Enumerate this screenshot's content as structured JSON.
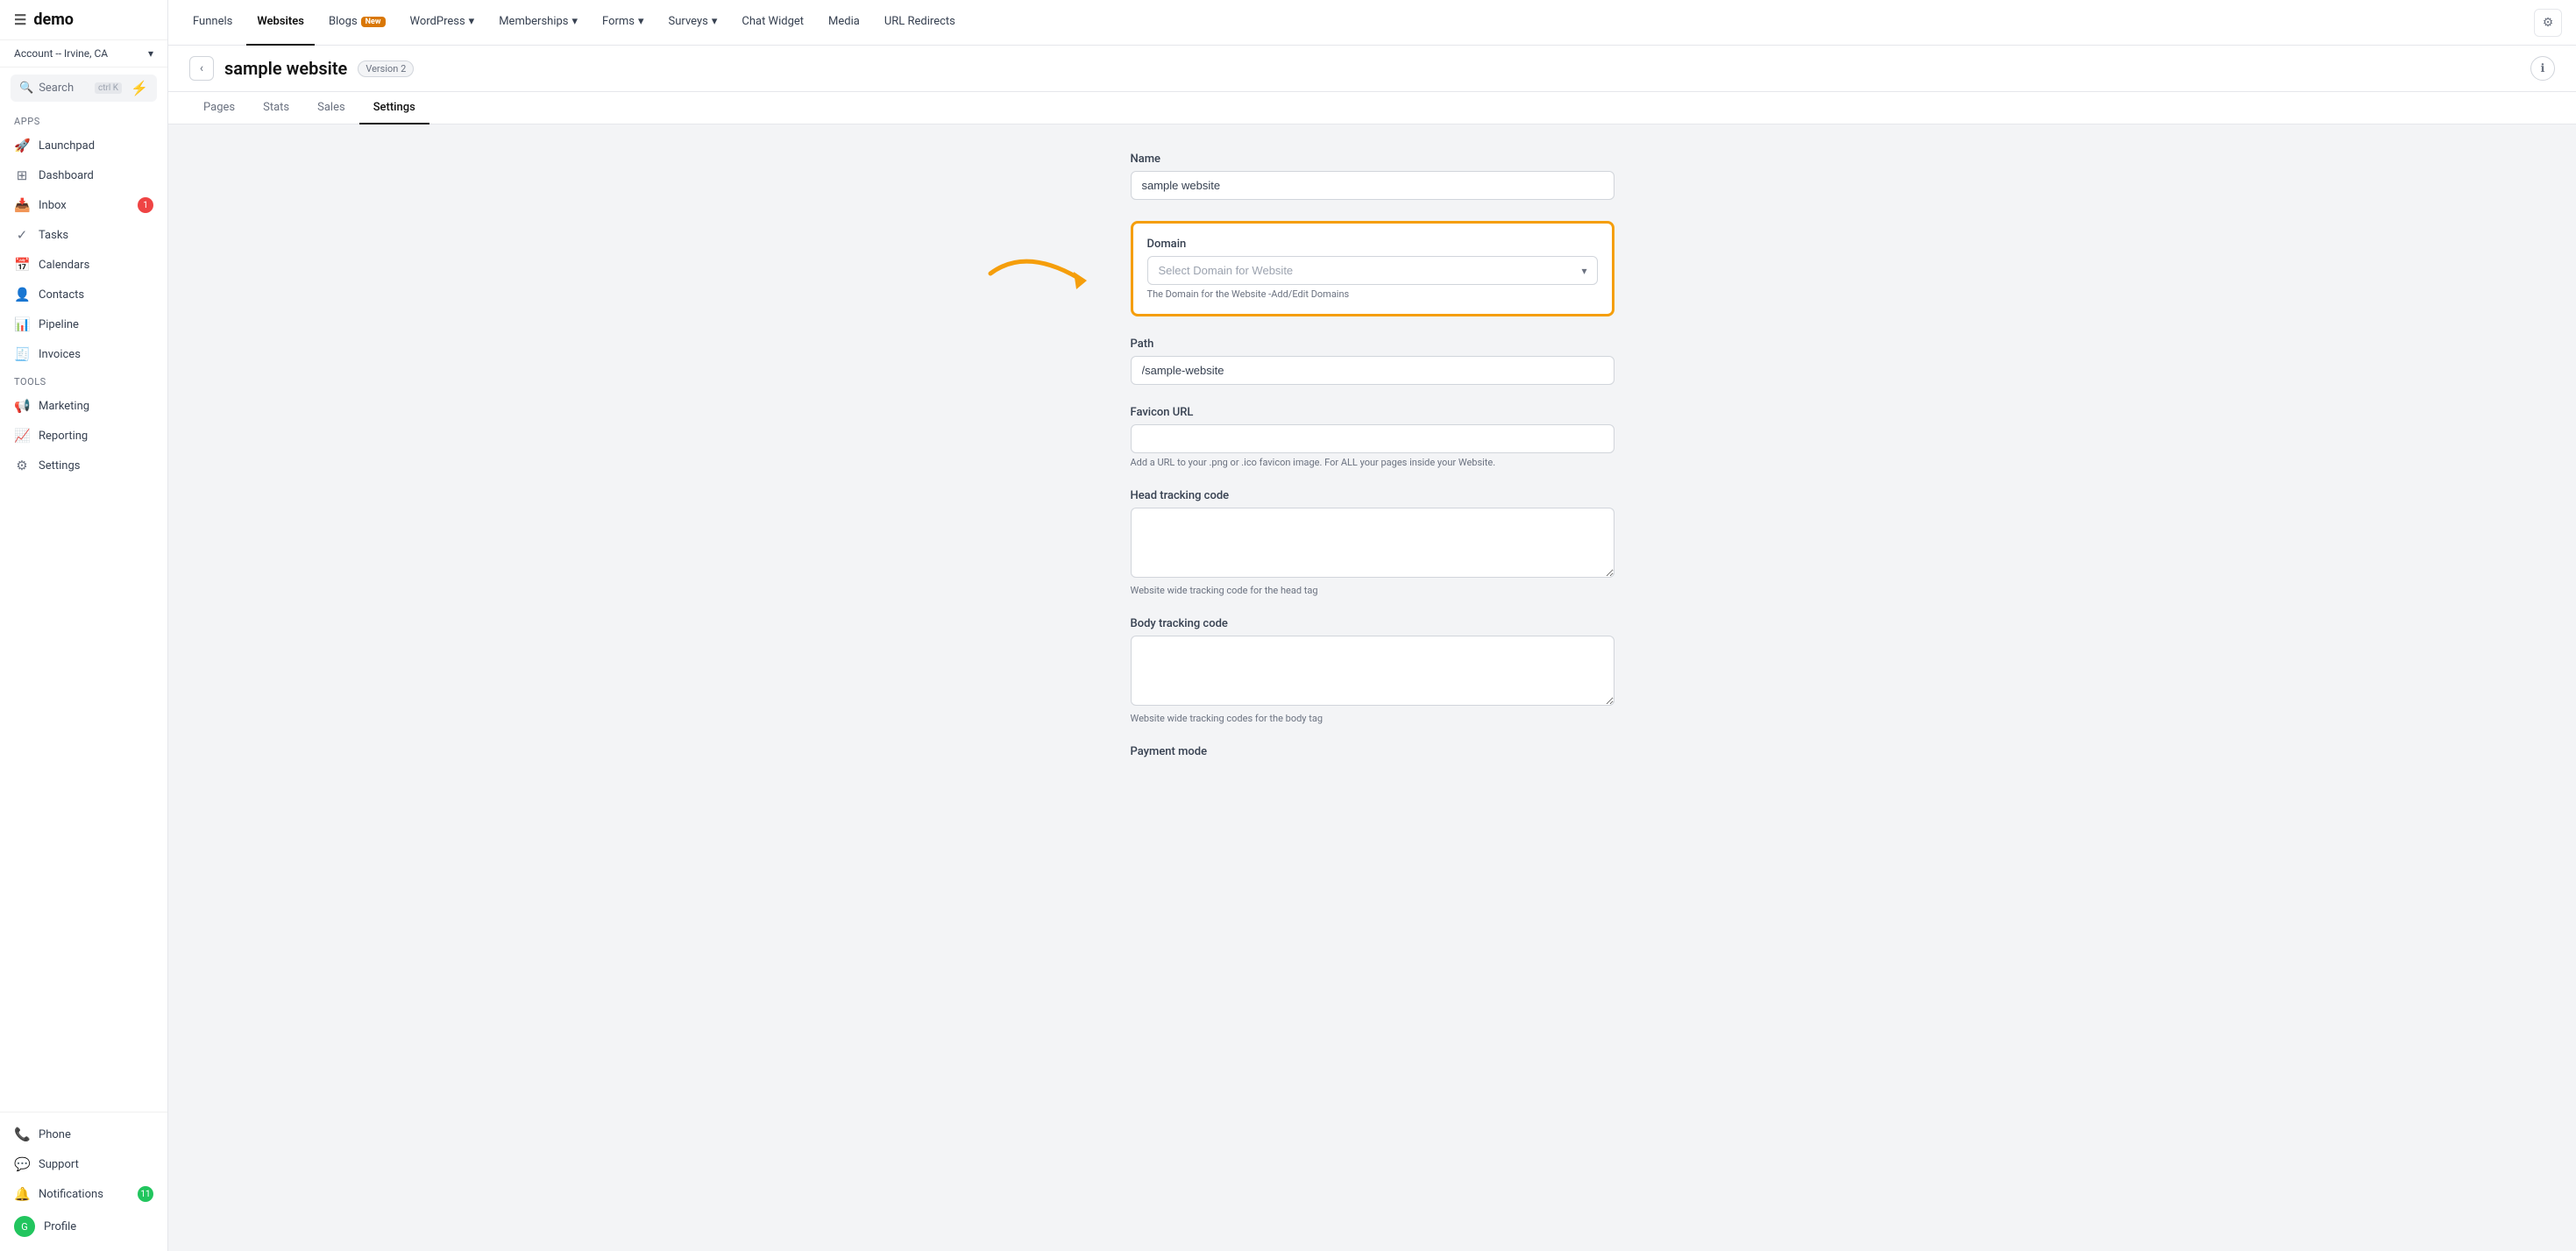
{
  "app": {
    "logo": "demo",
    "account": "Account -- Irvine, CA"
  },
  "sidebar": {
    "search_label": "Search",
    "search_shortcut": "ctrl K",
    "apps_section": "Apps",
    "tools_section": "Tools",
    "items": [
      {
        "id": "launchpad",
        "label": "Launchpad",
        "icon": "🚀",
        "badge": null
      },
      {
        "id": "dashboard",
        "label": "Dashboard",
        "icon": "⊞",
        "badge": null
      },
      {
        "id": "inbox",
        "label": "Inbox",
        "icon": "📥",
        "badge": "1"
      },
      {
        "id": "tasks",
        "label": "Tasks",
        "icon": "✓",
        "badge": null
      },
      {
        "id": "calendars",
        "label": "Calendars",
        "icon": "📅",
        "badge": null
      },
      {
        "id": "contacts",
        "label": "Contacts",
        "icon": "👤",
        "badge": null
      },
      {
        "id": "pipeline",
        "label": "Pipeline",
        "icon": "📊",
        "badge": null
      },
      {
        "id": "invoices",
        "label": "Invoices",
        "icon": "🧾",
        "badge": null
      }
    ],
    "tool_items": [
      {
        "id": "marketing",
        "label": "Marketing",
        "icon": "📢",
        "badge": null
      },
      {
        "id": "reporting",
        "label": "Reporting",
        "icon": "⚙",
        "badge": null
      },
      {
        "id": "settings",
        "label": "Settings",
        "icon": "⚙",
        "badge": null
      }
    ],
    "bottom_items": [
      {
        "id": "phone",
        "label": "Phone",
        "icon": "📞",
        "badge": null
      },
      {
        "id": "support",
        "label": "Support",
        "icon": "💬",
        "badge": null
      },
      {
        "id": "notifications",
        "label": "Notifications",
        "icon": "🔔",
        "badge": "11"
      },
      {
        "id": "profile",
        "label": "Profile",
        "icon": "👤",
        "badge": null
      }
    ]
  },
  "topnav": {
    "items": [
      {
        "id": "funnels",
        "label": "Funnels",
        "active": false,
        "badge": null
      },
      {
        "id": "websites",
        "label": "Websites",
        "active": true,
        "badge": null
      },
      {
        "id": "blogs",
        "label": "Blogs",
        "active": false,
        "badge": "New"
      },
      {
        "id": "wordpress",
        "label": "WordPress",
        "active": false,
        "badge": null,
        "dropdown": true
      },
      {
        "id": "memberships",
        "label": "Memberships",
        "active": false,
        "badge": null,
        "dropdown": true
      },
      {
        "id": "forms",
        "label": "Forms",
        "active": false,
        "badge": null,
        "dropdown": true
      },
      {
        "id": "surveys",
        "label": "Surveys",
        "active": false,
        "badge": null,
        "dropdown": true
      },
      {
        "id": "chat-widget",
        "label": "Chat Widget",
        "active": false,
        "badge": null
      },
      {
        "id": "media",
        "label": "Media",
        "active": false,
        "badge": null
      },
      {
        "id": "url-redirects",
        "label": "URL Redirects",
        "active": false,
        "badge": null
      }
    ]
  },
  "page": {
    "title": "sample website",
    "version": "Version 2",
    "tabs": [
      {
        "id": "pages",
        "label": "Pages",
        "active": false
      },
      {
        "id": "stats",
        "label": "Stats",
        "active": false
      },
      {
        "id": "sales",
        "label": "Sales",
        "active": false
      },
      {
        "id": "settings",
        "label": "Settings",
        "active": true
      }
    ]
  },
  "form": {
    "name_label": "Name",
    "name_value": "sample website",
    "domain_label": "Domain",
    "domain_placeholder": "Select Domain for Website",
    "domain_hint": "The Domain for the Website -Add/Edit Domains",
    "path_label": "Path",
    "path_value": "/sample-website",
    "favicon_label": "Favicon URL",
    "favicon_value": "",
    "favicon_hint": "Add a URL to your .png or .ico favicon image. For ALL your pages inside your Website.",
    "head_tracking_label": "Head tracking code",
    "head_tracking_value": "",
    "head_tracking_hint": "Website wide tracking code for the head tag",
    "body_tracking_label": "Body tracking code",
    "body_tracking_value": "",
    "body_tracking_hint": "Website wide tracking codes for the body tag",
    "payment_mode_label": "Payment mode"
  }
}
